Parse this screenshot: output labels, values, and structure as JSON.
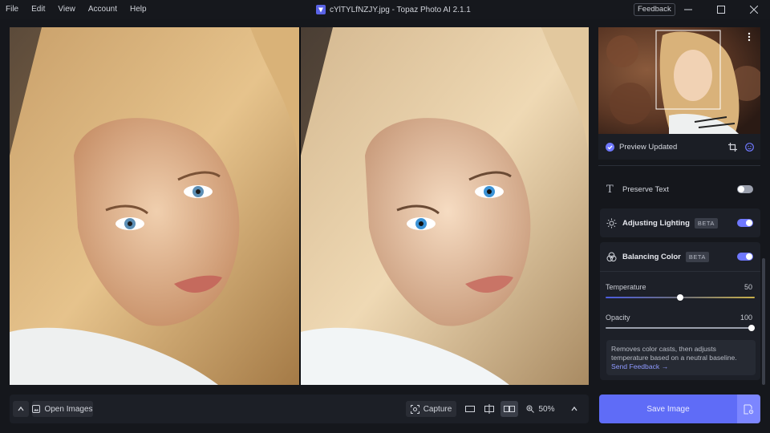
{
  "menu": [
    "File",
    "Edit",
    "View",
    "Account",
    "Help"
  ],
  "window": {
    "title": "cYlTYLfNZJY.jpg - Topaz Photo AI 2.1.1",
    "feedback_label": "Feedback"
  },
  "icons": {
    "app": "topaz-logo-icon",
    "minimize": "minimize-icon",
    "maximize": "maximize-icon",
    "close": "close-icon"
  },
  "bottombar": {
    "open_images_label": "Open Images",
    "capture_label": "Capture",
    "zoom": "50%"
  },
  "panel": {
    "preview_status": "Preview Updated",
    "preserve_text": {
      "label": "Preserve Text",
      "enabled": false
    },
    "lighting": {
      "label": "Adjusting Lighting",
      "badge": "BETA",
      "enabled": true
    },
    "balance": {
      "label": "Balancing Color",
      "badge": "BETA",
      "enabled": true,
      "temperature": {
        "label": "Temperature",
        "value": "50"
      },
      "opacity": {
        "label": "Opacity",
        "value": "100"
      },
      "info_text": "Removes color casts, then adjusts temperature based on a neutral baseline.",
      "info_link": "Send Feedback →"
    }
  },
  "save": {
    "label": "Save Image"
  },
  "colors": {
    "accent": "#6f78ff",
    "save": "#5f6cf7",
    "background": "#15171c",
    "panel": "#1d2028"
  }
}
